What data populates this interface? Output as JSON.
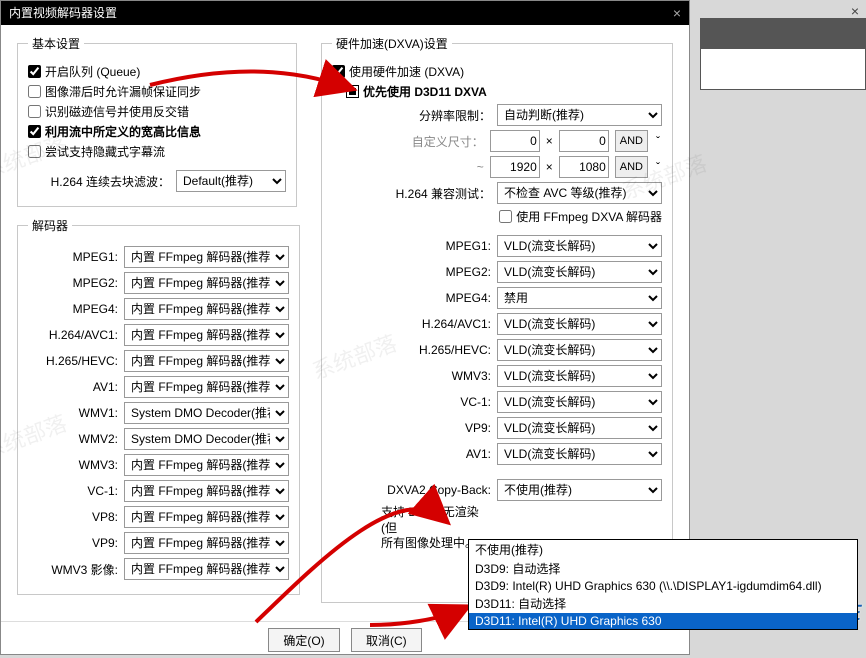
{
  "window": {
    "title": "内置视频解码器设置"
  },
  "basic": {
    "legend": "基本设置",
    "queue": "开启队列 (Queue)",
    "dropframe": "图像滞后时允许漏帧保证同步",
    "interlace": "识别磁迹信号并使用反交错",
    "aspect": "利用流中所定义的宽高比信息",
    "subtitle": "尝试支持隐藏式字幕流",
    "h264deblock_lbl": "H.264 连续去块滤波：",
    "h264deblock_val": "Default(推荐)"
  },
  "decoders": {
    "legend": "解码器",
    "items": [
      {
        "label": "MPEG1:",
        "value": "内置 FFmpeg 解码器(推荐"
      },
      {
        "label": "MPEG2:",
        "value": "内置 FFmpeg 解码器(推荐"
      },
      {
        "label": "MPEG4:",
        "value": "内置 FFmpeg 解码器(推荐"
      },
      {
        "label": "H.264/AVC1:",
        "value": "内置 FFmpeg 解码器(推荐"
      },
      {
        "label": "H.265/HEVC:",
        "value": "内置 FFmpeg 解码器(推荐"
      },
      {
        "label": "AV1:",
        "value": "内置 FFmpeg 解码器(推荐"
      },
      {
        "label": "WMV1:",
        "value": "System DMO Decoder(推荐"
      },
      {
        "label": "WMV2:",
        "value": "System DMO Decoder(推荐"
      },
      {
        "label": "WMV3:",
        "value": "内置 FFmpeg 解码器(推荐"
      },
      {
        "label": "VC-1:",
        "value": "内置 FFmpeg 解码器(推荐"
      },
      {
        "label": "VP8:",
        "value": "内置 FFmpeg 解码器(推荐"
      },
      {
        "label": "VP9:",
        "value": "内置 FFmpeg 解码器(推荐"
      },
      {
        "label": "WMV3 影像:",
        "value": "内置 FFmpeg 解码器(推荐"
      }
    ]
  },
  "hw": {
    "legend": "硬件加速(DXVA)设置",
    "use": "使用硬件加速 (DXVA)",
    "prefer": "优先使用 D3D11 DXVA",
    "reslimit_lbl": "分辨率限制：",
    "reslimit_val": "自动判断(推荐)",
    "customsize_lbl": "自定义尺寸：",
    "w1": "0",
    "h1": "0",
    "w2": "1920",
    "h2": "1080",
    "and": "AND",
    "tilde": "~",
    "x": "×",
    "compat_lbl": "H.264 兼容测试：",
    "compat_val": "不检查 AVC 等级(推荐)",
    "ffmpegdxva": "使用 FFmpeg DXVA 解码器",
    "modes": [
      {
        "label": "MPEG1:",
        "value": "VLD(流变长解码)"
      },
      {
        "label": "MPEG2:",
        "value": "VLD(流变长解码)"
      },
      {
        "label": "MPEG4:",
        "value": "禁用"
      },
      {
        "label": "H.264/AVC1:",
        "value": "VLD(流变长解码)"
      },
      {
        "label": "H.265/HEVC:",
        "value": "VLD(流变长解码)"
      },
      {
        "label": "WMV3:",
        "value": "VLD(流变长解码)"
      },
      {
        "label": "VC-1:",
        "value": "VLD(流变长解码)"
      },
      {
        "label": "VP9:",
        "value": "VLD(流变长解码)"
      },
      {
        "label": "AV1:",
        "value": "VLD(流变长解码)"
      }
    ],
    "copyback_lbl": "DXVA2 Copy-Back:",
    "copyback_val": "不使用(推荐)",
    "note": "支持 DXVA 无渲染(但<br>所有图像处理中。"
  },
  "dropdown": {
    "options": [
      "不使用(推荐)",
      "D3D9: 自动选择",
      "D3D9: Intel(R) UHD Graphics 630 (\\\\.\\DISPLAY1-igdumdim64.dll)",
      "D3D11: 自动选择",
      "D3D11: Intel(R) UHD Graphics 630"
    ],
    "selected_index": 4
  },
  "footer": {
    "ok": "确定(O)",
    "cancel": "取消(C)"
  },
  "watermarks": [
    "系统部落",
    "系统部落",
    "系统部落",
    "系统部落",
    "系统部落"
  ]
}
